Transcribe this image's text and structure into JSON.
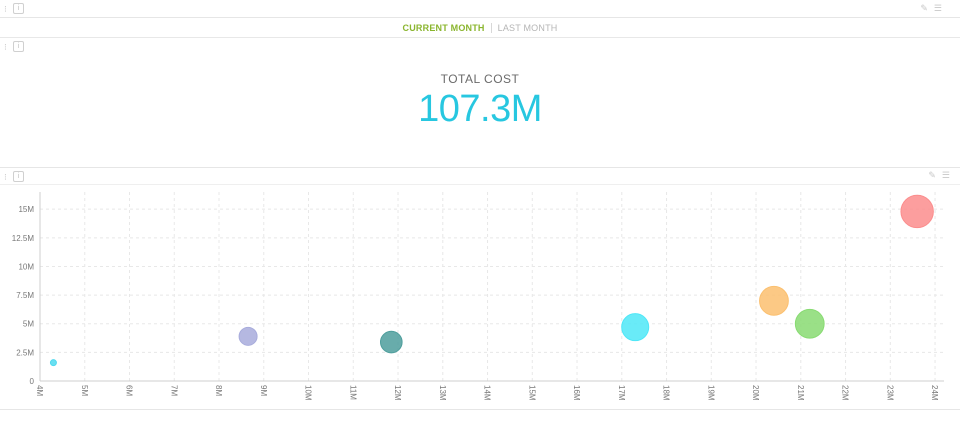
{
  "tabs": {
    "current": "CURRENT MONTH",
    "last": "LAST MONTH"
  },
  "kpi": {
    "label": "TOTAL COST",
    "value": "107.3M"
  },
  "icons": [
    "drag-handle-icon",
    "info-icon",
    "edit-icon",
    "menu-icon"
  ],
  "chart_data": {
    "type": "scatter",
    "title": "",
    "xlabel": "",
    "ylabel": "",
    "xlim": [
      4000000,
      24200000
    ],
    "ylim": [
      0,
      16500000
    ],
    "x_ticks": [
      "4M",
      "5M",
      "6M",
      "7M",
      "8M",
      "9M",
      "10M",
      "11M",
      "12M",
      "13M",
      "14M",
      "15M",
      "16M",
      "17M",
      "18M",
      "19M",
      "20M",
      "21M",
      "22M",
      "23M",
      "24M"
    ],
    "y_ticks": [
      "0",
      "2.5M",
      "5M",
      "7.5M",
      "10M",
      "12.5M",
      "15M"
    ],
    "grid": true,
    "legend": "none",
    "points": [
      {
        "x": 4300000,
        "y": 1600000,
        "size": 0.15,
        "color": "#4fd9ee"
      },
      {
        "x": 8650000,
        "y": 3900000,
        "size": 0.5,
        "color": "#a8acdc"
      },
      {
        "x": 11850000,
        "y": 3400000,
        "size": 0.6,
        "color": "#4e9e9c"
      },
      {
        "x": 17300000,
        "y": 4700000,
        "size": 0.75,
        "color": "#4fe7f7"
      },
      {
        "x": 20400000,
        "y": 7000000,
        "size": 0.8,
        "color": "#fbc070"
      },
      {
        "x": 21200000,
        "y": 5000000,
        "size": 0.8,
        "color": "#88db72"
      },
      {
        "x": 23600000,
        "y": 14800000,
        "size": 0.9,
        "color": "#fb8d8d"
      }
    ]
  }
}
